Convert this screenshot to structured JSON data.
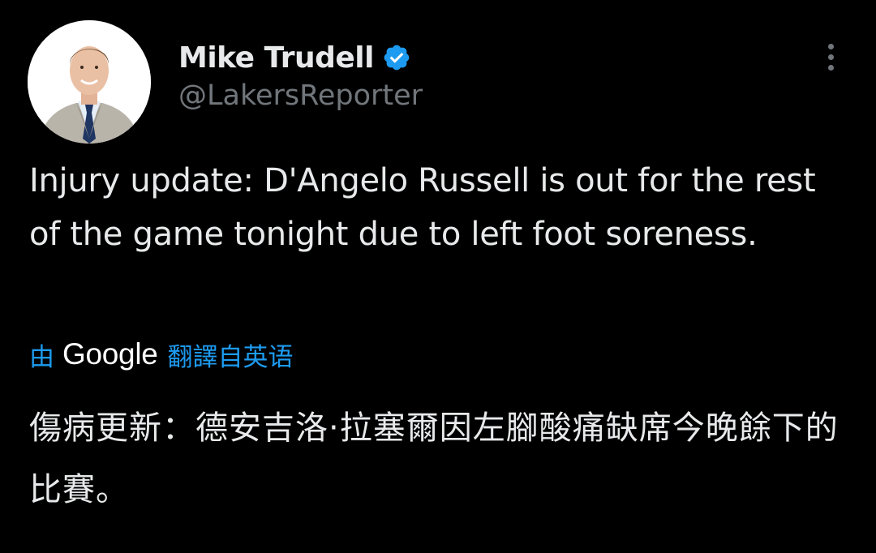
{
  "tweet": {
    "author": {
      "display_name": "Mike Trudell",
      "handle": "@LakersReporter",
      "verified_icon": "verified-badge-icon",
      "avatar": "profile-photo"
    },
    "more_icon": "more-vertical-icon",
    "text": "Injury update: D'Angelo Russell is out for the rest of the game tonight due to left foot soreness.",
    "translation": {
      "by_prefix": "由",
      "provider": "Google",
      "translated_from": "翻譯自英语",
      "text": "傷病更新：德安吉洛·拉塞爾因左腳酸痛缺席今晚餘下的比賽。"
    }
  },
  "colors": {
    "background": "#000000",
    "text": "#e7e9ea",
    "secondary": "#71767b",
    "accent": "#1d9bf0"
  }
}
